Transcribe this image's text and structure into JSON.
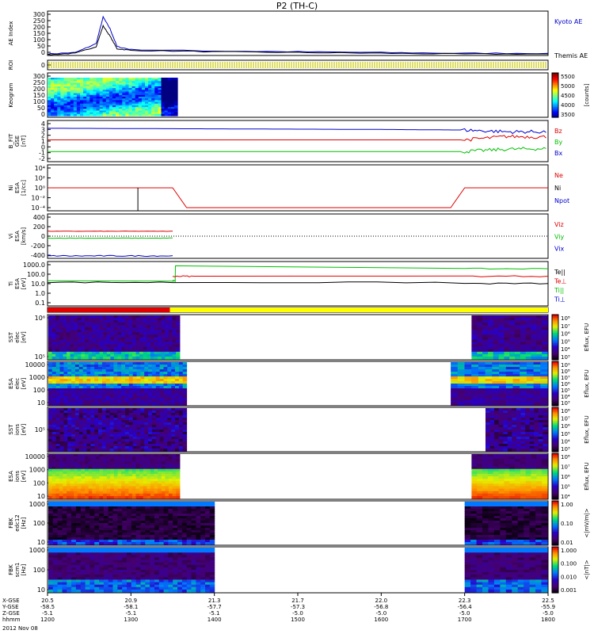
{
  "title": "P2 (TH-C)",
  "colors": {
    "kyoto": "#0000cc",
    "themis": "#000000",
    "red": "#e00000",
    "green": "#00c000",
    "blue": "#0000d0",
    "roi": "#c8c800",
    "flag_red": "#e00000",
    "flag_yellow": "#ffff00"
  },
  "panels": [
    {
      "id": "ae",
      "ylabel": [
        "AE Index"
      ],
      "ticks": [
        "300",
        "250",
        "200",
        "150",
        "100",
        "50",
        "0"
      ],
      "legend": [
        {
          "text": "Kyoto AE",
          "color": "#0000cc"
        },
        {
          "text": "Themis AE",
          "color": "#000000"
        }
      ]
    },
    {
      "id": "roi",
      "ylabel": [
        "ROI"
      ],
      "ticks": [
        "0"
      ],
      "legend": []
    },
    {
      "id": "keogram",
      "ylabel": [
        "Keogram"
      ],
      "ticks": [
        "300",
        "250",
        "200",
        "150",
        "100",
        "50",
        "0"
      ],
      "legend": []
    },
    {
      "id": "bfield",
      "ylabel": [
        "B_FIT",
        "GSE",
        "[nT]"
      ],
      "ticks": [
        "4",
        "3",
        "2",
        "1",
        "0",
        "-1",
        "-2"
      ],
      "legend": [
        {
          "text": "Bz",
          "color": "#e00000"
        },
        {
          "text": "By",
          "color": "#00c000"
        },
        {
          "text": "Bx",
          "color": "#0000d0"
        }
      ]
    },
    {
      "id": "density",
      "ylabel": [
        "Ni",
        "ESA",
        "[1/cc]"
      ],
      "ticks": [
        "10⁴",
        "10²",
        "10⁰",
        "10⁻²",
        "10⁻⁴"
      ],
      "legend": [
        {
          "text": "Ne",
          "color": "#e00000"
        },
        {
          "text": "Ni",
          "color": "#000000"
        },
        {
          "text": "Npot",
          "color": "#0000d0"
        }
      ]
    },
    {
      "id": "velocity",
      "ylabel": [
        "Vi",
        "ESA",
        "[km/s]"
      ],
      "ticks": [
        "400",
        "200",
        "0",
        "-200",
        "-400"
      ],
      "legend": [
        {
          "text": "Viz",
          "color": "#e00000"
        },
        {
          "text": "Viy",
          "color": "#00c000"
        },
        {
          "text": "Vix",
          "color": "#0000d0"
        }
      ]
    },
    {
      "id": "temp",
      "ylabel": [
        "Ti",
        "ESA",
        "[eV]"
      ],
      "ticks": [
        "1000.0",
        "100.0",
        "10.0",
        "1.0",
        "0.1"
      ],
      "legend": [
        {
          "text": "Te||",
          "color": "#000000"
        },
        {
          "text": "Te⊥",
          "color": "#e00000"
        },
        {
          "text": "Ti||",
          "color": "#00c000"
        },
        {
          "text": "Ti⊥",
          "color": "#0000d0"
        }
      ]
    },
    {
      "id": "flags",
      "ylabel": [],
      "ticks": [],
      "legend": []
    },
    {
      "id": "sst_e",
      "ylabel": [
        "SST",
        "elec",
        "[eV]"
      ],
      "ticks": [
        "10⁶",
        "10⁵"
      ],
      "legend": []
    },
    {
      "id": "esa_e",
      "ylabel": [
        "ESA",
        "elec",
        "[eV]"
      ],
      "ticks": [
        "10000",
        "1000",
        "100",
        "10"
      ],
      "legend": []
    },
    {
      "id": "sst_i",
      "ylabel": [
        "SST",
        "ions",
        "[eV]"
      ],
      "ticks": [
        "10⁵"
      ],
      "legend": []
    },
    {
      "id": "esa_i",
      "ylabel": [
        "ESA",
        "ions",
        "[eV]"
      ],
      "ticks": [
        "10000",
        "1000",
        "100",
        "10"
      ],
      "legend": []
    },
    {
      "id": "fbk1",
      "ylabel": [
        "FBK",
        "edc12",
        "[Hz]"
      ],
      "ticks": [
        "1000",
        "100",
        "10"
      ],
      "legend": []
    },
    {
      "id": "fbk2",
      "ylabel": [
        "FBK",
        "scm1",
        "[Hz]"
      ],
      "ticks": [
        "1000",
        "100",
        "10"
      ],
      "legend": []
    }
  ],
  "colorbars": [
    {
      "panel": "keogram",
      "ticks": [
        "5500",
        "5000",
        "4500",
        "4000",
        "3500"
      ],
      "label": "[counts]"
    },
    {
      "panel": "sst_e",
      "ticks": [
        "10⁸",
        "10⁷",
        "10⁶",
        "10⁵",
        "10⁴",
        "10³"
      ],
      "label": "Eflux, EFU"
    },
    {
      "panel": "esa_e",
      "ticks": [
        "10⁹",
        "10⁸",
        "10⁷",
        "10⁶",
        "10⁵",
        "10⁴",
        "10³"
      ],
      "label": "Eflux, EFU"
    },
    {
      "panel": "sst_i",
      "ticks": [
        "10⁸",
        "10⁷",
        "10⁶",
        "10⁵",
        "10⁴",
        "10³"
      ],
      "label": "Eflux, EFU"
    },
    {
      "panel": "esa_i",
      "ticks": [
        "10⁸",
        "10⁷",
        "10⁶",
        "10⁵",
        "10⁴"
      ],
      "label": "Eflux, EFU"
    },
    {
      "panel": "fbk1",
      "ticks": [
        "1.00",
        "0.10",
        "0.01"
      ],
      "label": "<|mV/m|>"
    },
    {
      "panel": "fbk2",
      "ticks": [
        "1.000",
        "0.100",
        "0.010",
        "0.001"
      ],
      "label": "<|nT|>"
    }
  ],
  "xaxis": {
    "row_labels": [
      "X-GSE",
      "Y-GSE",
      "Z-GSE",
      "hhmm"
    ],
    "date": "2012 Nov 08",
    "columns": [
      {
        "x": "20.5",
        "y": "-58.5",
        "z": "-5.1",
        "t": "1200"
      },
      {
        "x": "20.9",
        "y": "-58.1",
        "z": "-5.1",
        "t": "1300"
      },
      {
        "x": "21.3",
        "y": "-57.7",
        "z": "-5.1",
        "t": "1400"
      },
      {
        "x": "21.7",
        "y": "-57.3",
        "z": "-5.0",
        "t": "1500"
      },
      {
        "x": "22.0",
        "y": "-56.8",
        "z": "-5.0",
        "t": "1600"
      },
      {
        "x": "22.3",
        "y": "-56.4",
        "z": "-5.0",
        "t": "1700"
      },
      {
        "x": "22.5",
        "y": "-55.9",
        "z": "-5.0",
        "t": "1800"
      }
    ]
  },
  "chart_data": {
    "type": "line",
    "title": "P2 (TH-C)",
    "x_unit": "hhmm",
    "x_range": [
      "1200",
      "1800"
    ],
    "series": [
      {
        "name": "Kyoto AE",
        "panel": "ae",
        "x": [
          "1200",
          "1220",
          "1235",
          "1240",
          "1245",
          "1250",
          "1300",
          "1400",
          "1500",
          "1600",
          "1700",
          "1800"
        ],
        "values": [
          10,
          20,
          80,
          260,
          180,
          60,
          40,
          30,
          25,
          20,
          15,
          15
        ]
      },
      {
        "name": "Themis AE",
        "panel": "ae",
        "x": [
          "1200",
          "1220",
          "1235",
          "1240",
          "1245",
          "1250",
          "1300",
          "1400",
          "1500",
          "1600",
          "1700",
          "1800"
        ],
        "values": [
          5,
          15,
          60,
          200,
          130,
          45,
          35,
          25,
          20,
          15,
          10,
          10
        ]
      },
      {
        "name": "Bz",
        "panel": "bfield",
        "x": [
          "1200",
          "1400",
          "1600",
          "1700",
          "1730",
          "1800"
        ],
        "values": [
          1.2,
          1.2,
          1.2,
          1.2,
          1.8,
          1.7
        ]
      },
      {
        "name": "By",
        "panel": "bfield",
        "x": [
          "1200",
          "1400",
          "1600",
          "1700",
          "1730",
          "1800"
        ],
        "values": [
          -0.8,
          -0.8,
          -0.8,
          -0.8,
          -0.4,
          -0.3
        ]
      },
      {
        "name": "Bx",
        "panel": "bfield",
        "x": [
          "1200",
          "1400",
          "1600",
          "1700",
          "1730",
          "1800"
        ],
        "values": [
          3.2,
          3.1,
          3.0,
          2.9,
          2.6,
          2.6
        ]
      },
      {
        "name": "Ne",
        "panel": "density",
        "x": [
          "1200",
          "1330",
          "1340",
          "1650",
          "1700",
          "1800"
        ],
        "values": [
          1.0,
          1.0,
          0.0001,
          0.0001,
          1.0,
          1.0
        ]
      },
      {
        "name": "Viz",
        "panel": "velocity",
        "x": [
          "1200",
          "1330"
        ],
        "values": [
          100,
          100
        ]
      },
      {
        "name": "Viy",
        "panel": "velocity",
        "x": [
          "1200",
          "1330"
        ],
        "values": [
          -40,
          -40
        ]
      },
      {
        "name": "Vix",
        "panel": "velocity",
        "x": [
          "1200",
          "1330"
        ],
        "values": [
          -400,
          -400
        ]
      },
      {
        "name": "Ti||",
        "panel": "temp",
        "x": [
          "1200",
          "1330",
          "1332",
          "1700",
          "1800"
        ],
        "values": [
          30,
          30,
          1500,
          700,
          700
        ]
      },
      {
        "name": "Te⊥",
        "panel": "temp",
        "x": [
          "1330",
          "1345",
          "1700",
          "1800"
        ],
        "values": [
          100,
          100,
          100,
          100
        ]
      },
      {
        "name": "Te||",
        "panel": "temp",
        "x": [
          "1200",
          "1330",
          "1700",
          "1800"
        ],
        "values": [
          20,
          20,
          15,
          15
        ]
      }
    ]
  }
}
